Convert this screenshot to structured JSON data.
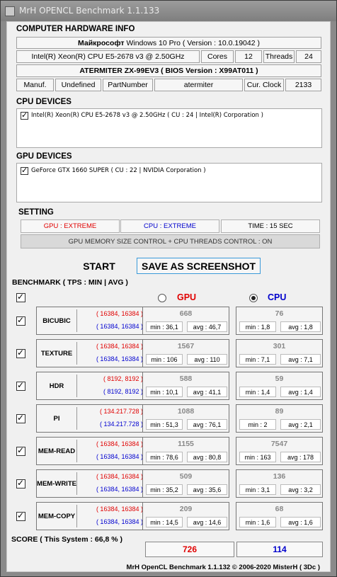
{
  "window": {
    "title": "MrH OPENCL Benchmark 1.1.133"
  },
  "hardware": {
    "section_title": "COMPUTER HARDWARE INFO",
    "os_vendor": "Майкрософт",
    "os_name": "Windows 10 Pro ( Version : 10.0.19042 )",
    "cpu_name": "Intel(R) Xeon(R) CPU E5-2678 v3 @ 2.50GHz",
    "cores_label": "Cores",
    "cores_value": "12",
    "threads_label": "Threads",
    "threads_value": "24",
    "board": "ATERMITER ZX-99EV3 ( BIOS Version : X99AT011 )",
    "manuf_label": "Manuf.",
    "manuf_value": "Undefined",
    "part_label": "PartNumber",
    "part_value": "atermiter",
    "clock_label": "Cur. Clock",
    "clock_value": "2133"
  },
  "cpu_devices": {
    "title": "CPU DEVICES",
    "items": [
      {
        "label": "Intel(R) Xeon(R) CPU E5-2678 v3 @ 2.50GHz ( CU : 24 | Intel(R) Corporation )",
        "checked": true
      }
    ]
  },
  "gpu_devices": {
    "title": "GPU DEVICES",
    "items": [
      {
        "label": "GeForce GTX 1660 SUPER ( CU : 22 | NVIDIA Corporation )",
        "checked": true
      }
    ]
  },
  "setting": {
    "title": "SETTING",
    "gpu_mode": "GPU : EXTREME",
    "cpu_mode": "CPU : EXTREME",
    "time": "TIME : 15 SEC",
    "memory_control": "GPU MEMORY SIZE CONTROL + CPU THREADS CONTROL : ON",
    "colors": {
      "gpu": "#e00000",
      "cpu": "#0000cc"
    }
  },
  "actions": {
    "start_label": "START",
    "screenshot_label": "SAVE AS SCREENSHOT"
  },
  "benchmark": {
    "title": "BENCHMARK ( TPS : MIN | AVG )",
    "gpu_label": "GPU",
    "cpu_label": "CPU",
    "selected": "cpu",
    "rows": [
      {
        "name": "BICUBIC",
        "gpu_dim": "( 16384, 16384 )",
        "cpu_dim": "( 16384, 16384 )",
        "gpu": {
          "score": "668",
          "min": "min : 36,1",
          "avg": "avg : 46,7"
        },
        "cpu": {
          "score": "76",
          "min": "min : 1,8",
          "avg": "avg : 1,8"
        }
      },
      {
        "name": "TEXTURE",
        "gpu_dim": "( 16384, 16384 )",
        "cpu_dim": "( 16384, 16384 )",
        "gpu": {
          "score": "1567",
          "min": "min : 106",
          "avg": "avg : 110"
        },
        "cpu": {
          "score": "301",
          "min": "min : 7,1",
          "avg": "avg : 7,1"
        }
      },
      {
        "name": "HDR",
        "gpu_dim": "( 8192, 8192 )",
        "cpu_dim": "( 8192, 8192 )",
        "gpu": {
          "score": "588",
          "min": "min : 10,1",
          "avg": "avg : 41,1"
        },
        "cpu": {
          "score": "59",
          "min": "min : 1,4",
          "avg": "avg : 1,4"
        }
      },
      {
        "name": "PI",
        "gpu_dim": "( 134.217.728 )",
        "cpu_dim": "( 134.217.728 )",
        "gpu": {
          "score": "1088",
          "min": "min : 51,3",
          "avg": "avg : 76,1"
        },
        "cpu": {
          "score": "89",
          "min": "min : 2",
          "avg": "avg : 2,1"
        }
      },
      {
        "name": "MEM-READ",
        "gpu_dim": "( 16384, 16384 )",
        "cpu_dim": "( 16384, 16384 )",
        "gpu": {
          "score": "1155",
          "min": "min : 78,6",
          "avg": "avg : 80,8"
        },
        "cpu": {
          "score": "7547",
          "min": "min : 163",
          "avg": "avg : 178"
        }
      },
      {
        "name": "MEM-WRITE",
        "gpu_dim": "( 16384, 16384 )",
        "cpu_dim": "( 16384, 16384 )",
        "gpu": {
          "score": "509",
          "min": "min : 35,2",
          "avg": "avg : 35,6"
        },
        "cpu": {
          "score": "136",
          "min": "min : 3,1",
          "avg": "avg : 3,2"
        }
      },
      {
        "name": "MEM-COPY",
        "gpu_dim": "( 16384, 16384 )",
        "cpu_dim": "( 16384, 16384 )",
        "gpu": {
          "score": "209",
          "min": "min : 14,5",
          "avg": "avg : 14,6"
        },
        "cpu": {
          "score": "68",
          "min": "min : 1,6",
          "avg": "avg : 1,6"
        }
      }
    ]
  },
  "score": {
    "label": "SCORE ( This System : 66,8 % )",
    "gpu": "726",
    "cpu": "114"
  },
  "footer": "MrH OpenCL Benchmark 1.1.132  ©  2006-2020 MisterH ( 3Dc )"
}
